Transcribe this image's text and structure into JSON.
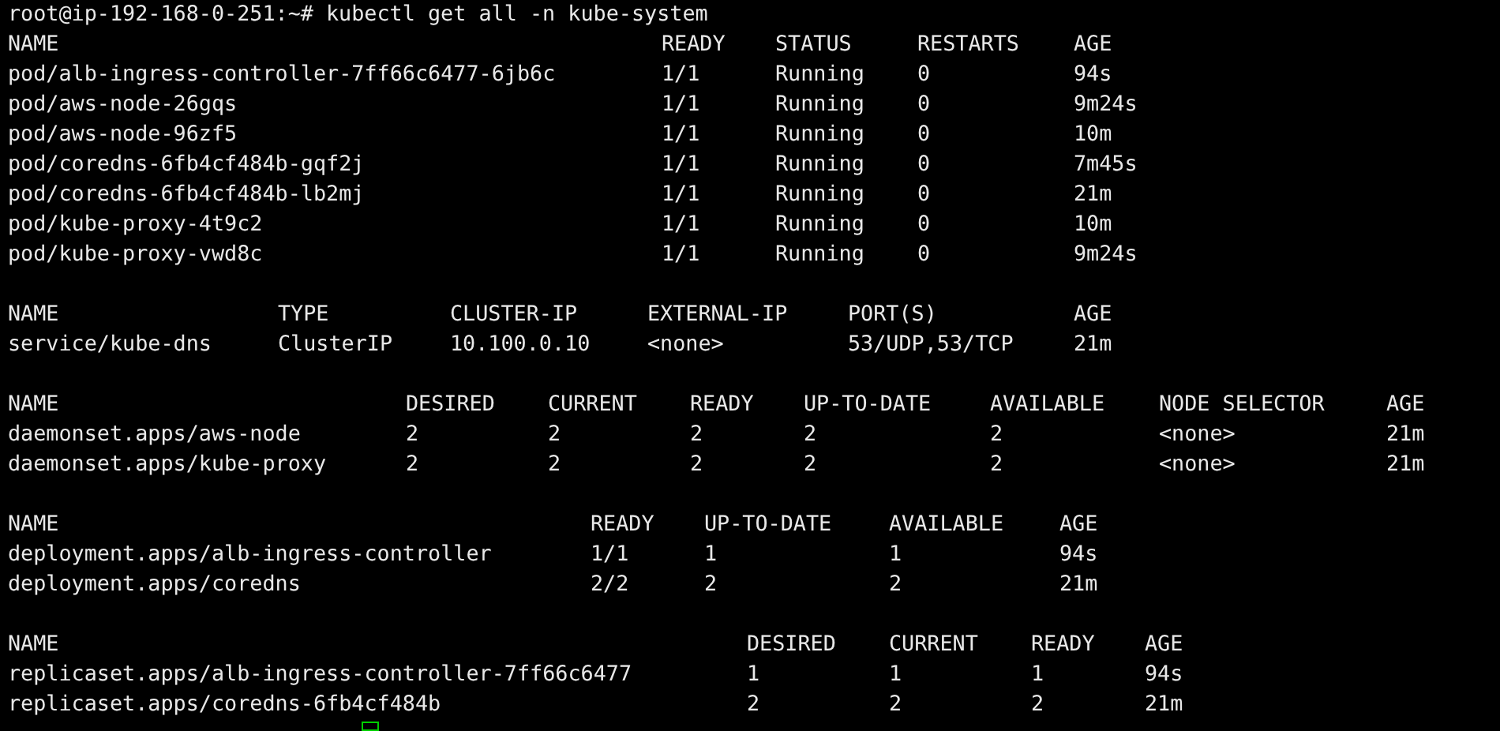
{
  "command_line": {
    "prompt": "root@ip-192-168-0-251:~#",
    "command": "kubectl get all -n kube-system"
  },
  "tables": [
    {
      "columns": [
        "NAME",
        "READY",
        "STATUS",
        "RESTARTS",
        "AGE"
      ],
      "rows": [
        [
          "pod/alb-ingress-controller-7ff66c6477-6jb6c",
          "1/1",
          "Running",
          "0",
          "94s"
        ],
        [
          "pod/aws-node-26gqs",
          "1/1",
          "Running",
          "0",
          "9m24s"
        ],
        [
          "pod/aws-node-96zf5",
          "1/1",
          "Running",
          "0",
          "10m"
        ],
        [
          "pod/coredns-6fb4cf484b-gqf2j",
          "1/1",
          "Running",
          "0",
          "7m45s"
        ],
        [
          "pod/coredns-6fb4cf484b-lb2mj",
          "1/1",
          "Running",
          "0",
          "21m"
        ],
        [
          "pod/kube-proxy-4t9c2",
          "1/1",
          "Running",
          "0",
          "10m"
        ],
        [
          "pod/kube-proxy-vwd8c",
          "1/1",
          "Running",
          "0",
          "9m24s"
        ]
      ]
    },
    {
      "columns": [
        "NAME",
        "TYPE",
        "CLUSTER-IP",
        "EXTERNAL-IP",
        "PORT(S)",
        "AGE"
      ],
      "rows": [
        [
          "service/kube-dns",
          "ClusterIP",
          "10.100.0.10",
          "<none>",
          "53/UDP,53/TCP",
          "21m"
        ]
      ]
    },
    {
      "columns": [
        "NAME",
        "DESIRED",
        "CURRENT",
        "READY",
        "UP-TO-DATE",
        "AVAILABLE",
        "NODE SELECTOR",
        "AGE"
      ],
      "rows": [
        [
          "daemonset.apps/aws-node",
          "2",
          "2",
          "2",
          "2",
          "2",
          "<none>",
          "21m"
        ],
        [
          "daemonset.apps/kube-proxy",
          "2",
          "2",
          "2",
          "2",
          "2",
          "<none>",
          "21m"
        ]
      ]
    },
    {
      "columns": [
        "NAME",
        "READY",
        "UP-TO-DATE",
        "AVAILABLE",
        "AGE"
      ],
      "rows": [
        [
          "deployment.apps/alb-ingress-controller",
          "1/1",
          "1",
          "1",
          "94s"
        ],
        [
          "deployment.apps/coredns",
          "2/2",
          "2",
          "2",
          "21m"
        ]
      ]
    },
    {
      "columns": [
        "NAME",
        "DESIRED",
        "CURRENT",
        "READY",
        "AGE"
      ],
      "rows": [
        [
          "replicaset.apps/alb-ingress-controller-7ff66c6477",
          "1",
          "1",
          "1",
          "94s"
        ],
        [
          "replicaset.apps/coredns-6fb4cf484b",
          "2",
          "2",
          "2",
          "21m"
        ]
      ]
    }
  ]
}
